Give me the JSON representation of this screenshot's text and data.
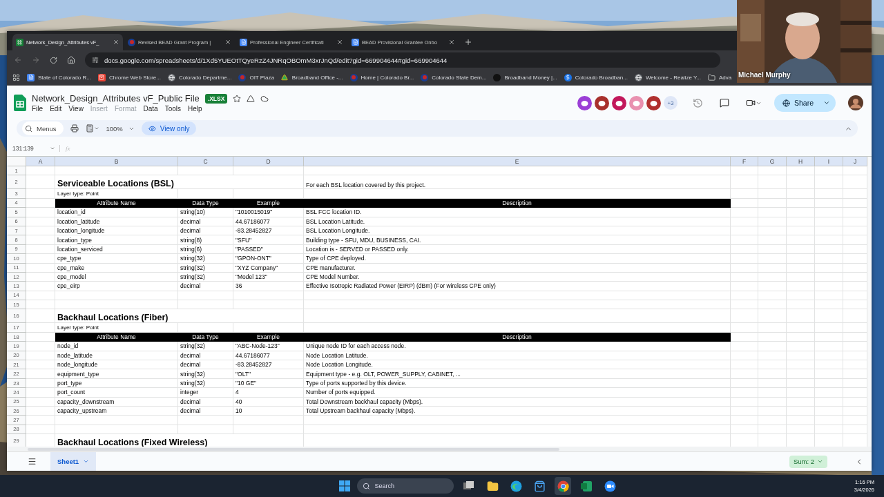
{
  "webcam": {
    "name": "Michael Murphy"
  },
  "browser": {
    "tabs": [
      {
        "title": "Network_Design_Attributes vF_",
        "kind": "sheets",
        "selected": true
      },
      {
        "title": "Revised BEAD Grant Program |",
        "kind": "site",
        "selected": false
      },
      {
        "title": "Professional Engineer Certificati",
        "kind": "docs",
        "selected": false
      },
      {
        "title": "BEAD Provisional Grantee Onbo",
        "kind": "docs",
        "selected": false
      }
    ],
    "address": "docs.google.com/spreadsheets/d/1Xd5YUEOtTQyeRzZ4JNRqOBOmM3xrJnQd/edit?gid=669904644#gid=669904644",
    "bookmarks": [
      {
        "label": "State of Colorado R...",
        "kind": "docs"
      },
      {
        "label": "Chrome Web Store...",
        "kind": "store"
      },
      {
        "label": "Colorado Departme...",
        "kind": "globe"
      },
      {
        "label": "OIT Plaza",
        "kind": "site"
      },
      {
        "label": "Broadband Office -...",
        "kind": "drive"
      },
      {
        "label": "Home | Colorado Br...",
        "kind": "site"
      },
      {
        "label": "Colorado State Dem...",
        "kind": "site"
      },
      {
        "label": "Broadband Money |...",
        "kind": "dark"
      },
      {
        "label": "Colorado Broadban...",
        "kind": "dollar"
      },
      {
        "label": "Welcome - Realize Y...",
        "kind": "globe"
      },
      {
        "label": "Adva",
        "kind": "folder"
      }
    ]
  },
  "sheets": {
    "title": "Network_Design_Attributes vF_Public File",
    "badge": ".XLSX",
    "menu": [
      {
        "label": "File",
        "disabled": false
      },
      {
        "label": "Edit",
        "disabled": false
      },
      {
        "label": "View",
        "disabled": false
      },
      {
        "label": "Insert",
        "disabled": true
      },
      {
        "label": "Format",
        "disabled": true
      },
      {
        "label": "Data",
        "disabled": false
      },
      {
        "label": "Tools",
        "disabled": false
      },
      {
        "label": "Help",
        "disabled": false
      }
    ],
    "collaborators": [
      {
        "color": "#9b3fd6"
      },
      {
        "color": "#a8302c"
      },
      {
        "color": "#c2185b"
      },
      {
        "color": "#e991b0"
      },
      {
        "color": "#b0302f"
      }
    ],
    "more_collaborators": "+3",
    "share": "Share",
    "search": "Menus",
    "zoom": "100%",
    "mode": "View only",
    "name_box": "131:139",
    "fx": "fx",
    "columns": [
      "A",
      "B",
      "C",
      "D",
      "E",
      "F",
      "G",
      "H",
      "I",
      "J"
    ],
    "rows": [
      {
        "number": "1",
        "kind": "blank"
      },
      {
        "number": "2",
        "kind": "title",
        "title": "Serviceable Locations (BSL)",
        "note": "For each BSL location covered by this project."
      },
      {
        "number": "3",
        "kind": "layer",
        "text": "Layer type: Point"
      },
      {
        "number": "4",
        "kind": "header",
        "cells": [
          "Attribute Name",
          "Data Type",
          "Example",
          "Description"
        ]
      },
      {
        "number": "5",
        "kind": "data",
        "cells": [
          "location_id",
          "string(10)",
          "\"1010015019\"",
          "BSL FCC location ID."
        ]
      },
      {
        "number": "6",
        "kind": "data",
        "cells": [
          "location_latitude",
          "decimal",
          "44.67186077",
          "BSL Location Latitude."
        ]
      },
      {
        "number": "7",
        "kind": "data",
        "cells": [
          "location_longitude",
          "decimal",
          "-83.28452827",
          "BSL Location Longitude."
        ]
      },
      {
        "number": "8",
        "kind": "data",
        "cells": [
          "location_type",
          "string(8)",
          "\"SFU\"",
          "Building type - SFU, MDU, BUSINESS, CAI."
        ]
      },
      {
        "number": "9",
        "kind": "data",
        "cells": [
          "location_serviced",
          "string(6)",
          "\"PASSED\"",
          "Location is - SERVED or PASSED only."
        ]
      },
      {
        "number": "10",
        "kind": "data",
        "cells": [
          "cpe_type",
          "string(32)",
          "\"GPON-ONT\"",
          "Type of CPE deployed."
        ]
      },
      {
        "number": "11",
        "kind": "data",
        "cells": [
          "cpe_make",
          "string(32)",
          "\"XYZ Company\"",
          "CPE manufacturer."
        ]
      },
      {
        "number": "12",
        "kind": "data",
        "cells": [
          "cpe_model",
          "string(32)",
          "\"Model 123\"",
          "CPE Model Number."
        ]
      },
      {
        "number": "13",
        "kind": "data",
        "cells": [
          "cpe_eirp",
          "decimal",
          "36",
          "Effective Isotropic Radiated Power (EIRP) (dBm) (For wireless CPE only)"
        ]
      },
      {
        "number": "14",
        "kind": "blank"
      },
      {
        "number": "15",
        "kind": "blank"
      },
      {
        "number": "16",
        "kind": "title",
        "title": "Backhaul Locations (Fiber)"
      },
      {
        "number": "17",
        "kind": "layer",
        "text": "Layer type: Point"
      },
      {
        "number": "18",
        "kind": "header",
        "cells": [
          "Attribute Name",
          "Data Type",
          "Example",
          "Description"
        ]
      },
      {
        "number": "19",
        "kind": "data",
        "cells": [
          "node_id",
          "string(32)",
          "\"ABC-Node-123\"",
          "Unique node ID for each access node."
        ]
      },
      {
        "number": "20",
        "kind": "data",
        "cells": [
          "node_latitude",
          "decimal",
          "44.67186077",
          "Node Location Latitude."
        ]
      },
      {
        "number": "21",
        "kind": "data",
        "cells": [
          "node_longitude",
          "decimal",
          "-83.28452827",
          "Node Location Longitude."
        ]
      },
      {
        "number": "22",
        "kind": "data",
        "cells": [
          "equipment_type",
          "string(32)",
          "\"OLT\"",
          "Equipment type - e.g. OLT, POWER_SUPPLY, CABINET, ..."
        ]
      },
      {
        "number": "23",
        "kind": "data",
        "cells": [
          "port_type",
          "string(32)",
          "\"10 GE\"",
          "Type of ports supported by this device."
        ]
      },
      {
        "number": "24",
        "kind": "data",
        "cells": [
          "port_count",
          "integer",
          "4",
          "Number of ports equipped."
        ]
      },
      {
        "number": "25",
        "kind": "data",
        "cells": [
          "capacity_downstream",
          "decimal",
          "40",
          "Total Downstream backhaul capacity (Mbps)."
        ]
      },
      {
        "number": "26",
        "kind": "data",
        "cells": [
          "capacity_upstream",
          "decimal",
          "10",
          "Total Upstream backhaul capacity (Mbps)."
        ]
      },
      {
        "number": "27",
        "kind": "blank"
      },
      {
        "number": "28",
        "kind": "blank"
      },
      {
        "number": "29",
        "kind": "title",
        "title": "Backhaul Locations (Fixed Wireless)"
      }
    ],
    "sheet_tab": {
      "label": "Sheet1",
      "selected": true
    },
    "sum": "Sum: 2"
  },
  "taskbar": {
    "search": "Search",
    "apps": [
      {
        "kind": "taskview",
        "selected": false
      },
      {
        "kind": "files",
        "selected": false
      },
      {
        "kind": "edge",
        "selected": false
      },
      {
        "kind": "store",
        "selected": false
      },
      {
        "kind": "chrome",
        "selected": true
      },
      {
        "kind": "excel",
        "selected": false
      },
      {
        "kind": "zoom",
        "selected": false
      }
    ],
    "time": "1:16 PM",
    "date": "3/4/2026"
  }
}
